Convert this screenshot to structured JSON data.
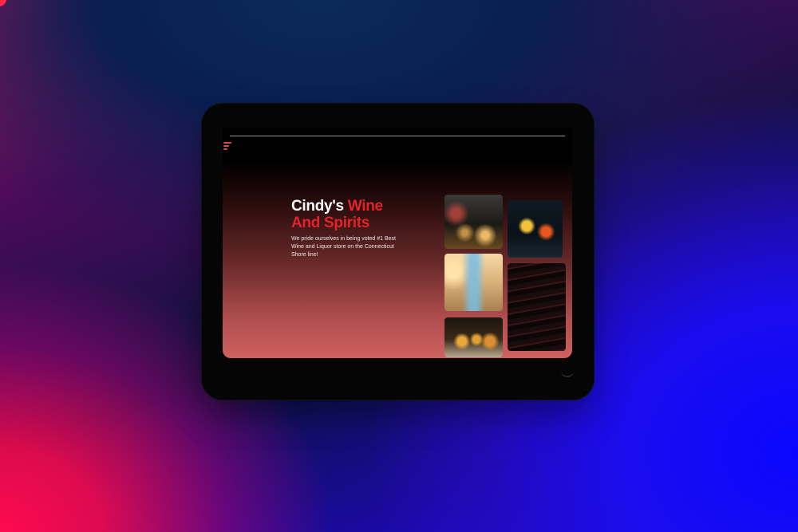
{
  "site": {
    "title_line1": "Cindy's ",
    "title_accent1": "Wine",
    "title_accent2": "And Spirits",
    "tagline": "We pride ourselves in being voted #1 Best Wine and Liquor store on the Connecticut Shore line!"
  },
  "icons": {
    "menu": "hamburger-menu-icon"
  },
  "gallery": [
    {
      "name": "store-shelf-photo",
      "subject": "bottles on shelf with candles"
    },
    {
      "name": "cocktail-photo",
      "subject": "yellow cocktail with orange"
    },
    {
      "name": "gin-bottles-photo",
      "subject": "gin bottles on backlit shelf"
    },
    {
      "name": "wine-rack-photo",
      "subject": "wine rack bottles"
    },
    {
      "name": "ice-bucket-photo",
      "subject": "beer bottles in ice bucket"
    }
  ],
  "colors": {
    "accent": "#e3232a",
    "title": "#ffffff",
    "hero_bottom": "#d06060"
  }
}
